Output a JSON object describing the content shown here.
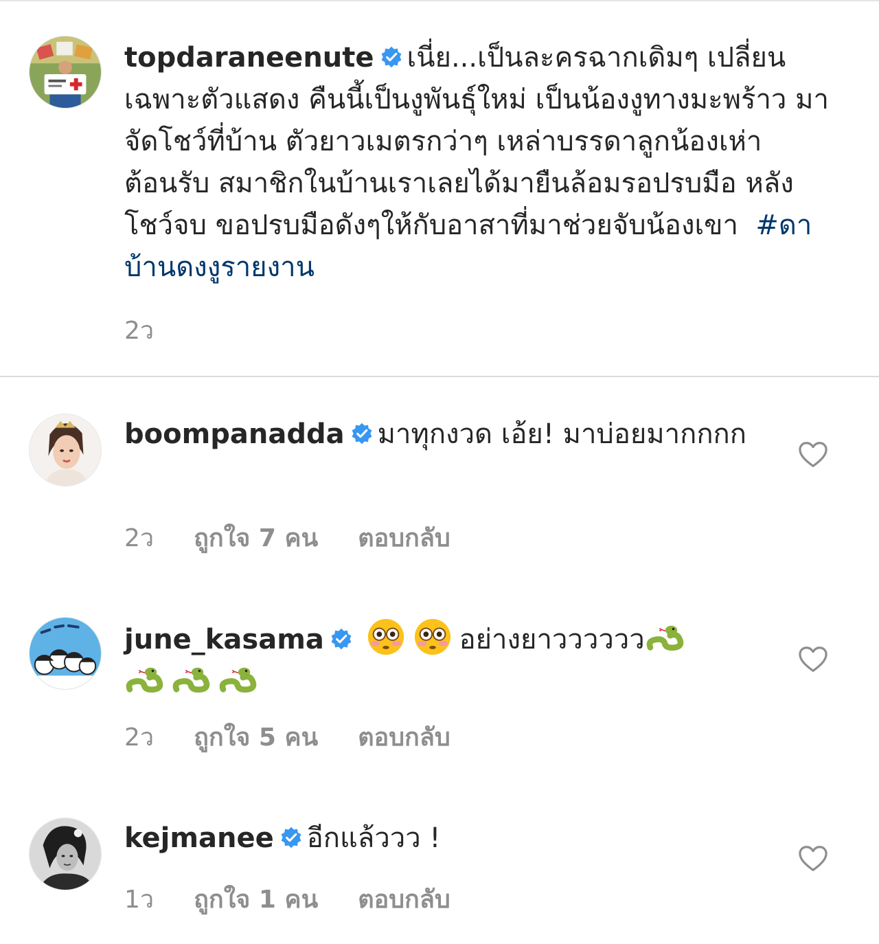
{
  "caption": {
    "username": "topdaraneenute",
    "text": "เนี่ย...เป็นละครฉากเดิมๆ เปลี่ยนเฉพาะตัวแสดง คืนนี้เป็นงูพันธุ์ใหม่ เป็นน้องงูทางมะพร้าว มาจัดโชว์ที่บ้าน  ตัวยาวเมตรกว่าๆ เหล่าบรรดาลูกน้องเห่าต้อนรับ สมาชิกในบ้านเราเลยได้มายืนล้อมรอปรบมือ หลังโชว์จบ ขอปรบมือดังๆให้กับอาสาที่มาช่วยจับน้องเขา",
    "hashtag": "#ดาบ้านดงงูรายงาน",
    "time": "2ว"
  },
  "comments": [
    {
      "username": "boompanadda",
      "text": "มาทุกงวด เอ้ย! มาบ่อยมากกกก",
      "time": "2ว",
      "likes": "ถูกใจ 7 คน",
      "reply": "ตอบกลับ"
    },
    {
      "username": "june_kasama",
      "text": "อย่างยาวววววว",
      "emoji_before": [
        "flushed-face",
        "flushed-face"
      ],
      "emoji_after": [
        "snake",
        "snake",
        "snake",
        "snake"
      ],
      "time": "2ว",
      "likes": "ถูกใจ 5 คน",
      "reply": "ตอบกลับ"
    },
    {
      "username": "kejmanee",
      "text": "อีกแล้ววว !",
      "time": "1ว",
      "likes": "ถูกใจ 1 คน",
      "reply": "ตอบกลับ"
    }
  ],
  "colors": {
    "verified": "#3897f0",
    "hashtag": "#00376b",
    "meta": "#8e8e8e",
    "divider": "#dbdbdb"
  }
}
